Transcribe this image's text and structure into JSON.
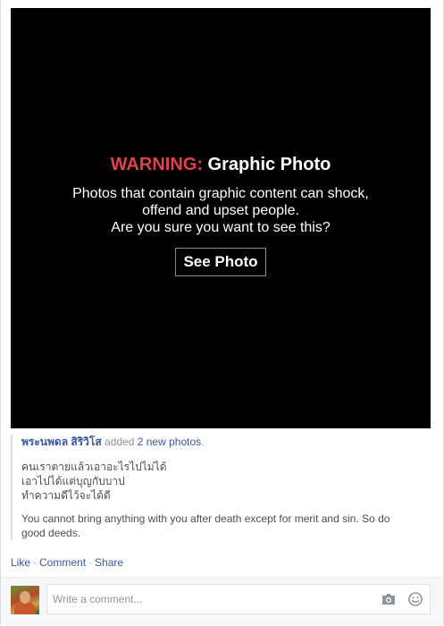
{
  "media": {
    "warning_label": "WARNING:",
    "warning_subject": "Graphic Photo",
    "warning_lines": [
      "Photos that contain graphic content can shock,",
      "offend and upset people.",
      "Are you sure you want to see this?"
    ],
    "see_photo_label": "See Photo",
    "warning_color": "#e0424b"
  },
  "post": {
    "author": "พระนพดล สิริวิโส",
    "action_text": "added",
    "photos_link": "2 new photos",
    "trailing": ".",
    "thai_lines": [
      "คนเราตายแล้วเอาอะไรไปไม่ได้",
      "เอาไปได้แต่บุญกับบาป",
      "ทำความดีไว้จะได้ดี"
    ],
    "english_text": "You cannot bring anything with you after death except for merit and sin. So do good deeds."
  },
  "actions": {
    "like": "Like",
    "comment": "Comment",
    "share": "Share",
    "separator": "·"
  },
  "comment_box": {
    "placeholder": "Write a comment...",
    "icons": [
      "avatar",
      "camera-icon",
      "smile-icon"
    ]
  },
  "colors": {
    "link": "#3b5998",
    "muted": "#90949c",
    "text": "#4b4f56"
  }
}
